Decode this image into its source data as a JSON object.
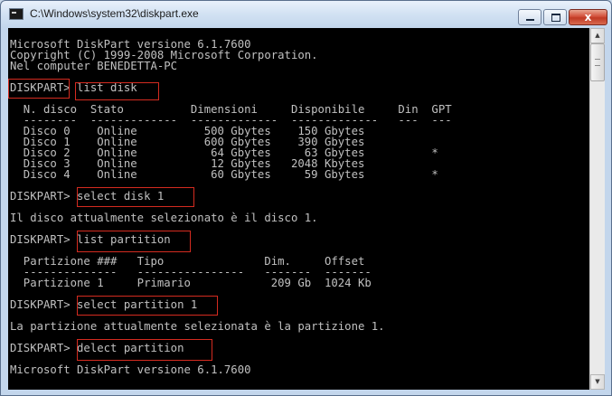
{
  "window": {
    "title": "C:\\Windows\\system32\\diskpart.exe",
    "close_glyph": "x"
  },
  "scrollbar": {
    "up_glyph": "▲",
    "down_glyph": "▼"
  },
  "console": {
    "lines": [
      "Microsoft DiskPart versione 6.1.7600",
      "Copyright (C) 1999-2008 Microsoft Corporation.",
      "Nel computer BENEDETTA-PC",
      "",
      "DISKPART> list disk",
      "",
      "  N. disco  Stato          Dimensioni     Disponibile     Din  GPT",
      "  --------  -------------  -------------  -------------   ---  ---",
      "  Disco 0    Online          500 Gbytes    150 Gbytes",
      "  Disco 1    Online          600 Gbytes    390 Gbytes",
      "  Disco 2    Online           64 Gbytes     63 Gbytes          *",
      "  Disco 3    Online           12 Gbytes   2048 Kbytes",
      "  Disco 4    Online           60 Gbytes     59 Gbytes          *",
      "",
      "DISKPART> select disk 1",
      "",
      "Il disco attualmente selezionato è il disco 1.",
      "",
      "DISKPART> list partition",
      "",
      "  Partizione ###   Tipo               Dim.     Offset",
      "  --------------   ----------------   -------  -------",
      "  Partizione 1     Primario            209 Gb  1024 Kb",
      "",
      "DISKPART> select partition 1",
      "",
      "La partizione attualmente selezionata è la partizione 1.",
      "",
      "DISKPART> delect partition",
      "",
      "Microsoft DiskPart versione 6.1.7600"
    ]
  }
}
